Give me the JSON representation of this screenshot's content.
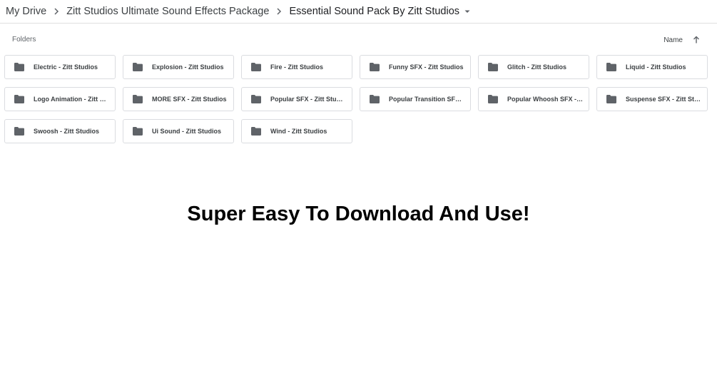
{
  "breadcrumb": {
    "items": [
      {
        "label": "My Drive"
      },
      {
        "label": "Zitt Studios Ultimate Sound Effects Package"
      },
      {
        "label": "Essential Sound Pack By Zitt Studios"
      }
    ]
  },
  "section": {
    "folders_label": "Folders",
    "sort_label": "Name",
    "sort_icon": "arrow-up-icon"
  },
  "folders": [
    {
      "name": "Electric - Zitt Studios"
    },
    {
      "name": "Explosion - Zitt Studios"
    },
    {
      "name": "Fire - Zitt Studios"
    },
    {
      "name": "Funny SFX - Zitt Studios"
    },
    {
      "name": "Glitch - Zitt Studios"
    },
    {
      "name": "Liquid - Zitt Studios"
    },
    {
      "name": "Logo Animation - Zitt Studios"
    },
    {
      "name": "MORE SFX - Zitt Studios"
    },
    {
      "name": "Popular SFX - Zitt Studios"
    },
    {
      "name": "Popular Transition SFX - Zitt Studios"
    },
    {
      "name": "Popular Whoosh SFX - Zitt Studios"
    },
    {
      "name": "Suspense SFX - Zitt Studios"
    },
    {
      "name": "Swoosh - Zitt Studios"
    },
    {
      "name": "Ui Sound - Zitt Studios"
    },
    {
      "name": "Wind - Zitt Studios"
    }
  ],
  "headline": "Super Easy To Download And Use!",
  "colors": {
    "folder_icon": "#5f6368",
    "border": "#dadce0",
    "text": "#3c4043"
  }
}
